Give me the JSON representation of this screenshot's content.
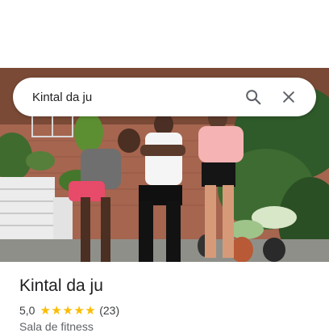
{
  "search": {
    "query": "Kintal da ju",
    "search_icon": "search-icon",
    "clear_icon": "close-icon"
  },
  "photo": {
    "description_icon": "place-photo"
  },
  "place": {
    "name": "Kintal da ju",
    "rating": "5,0",
    "stars": 5,
    "review_count": "(23)",
    "category": "Sala de fitness"
  },
  "colors": {
    "star": "#fbbc04",
    "title": "#202124",
    "secondary": "#5f6368"
  }
}
